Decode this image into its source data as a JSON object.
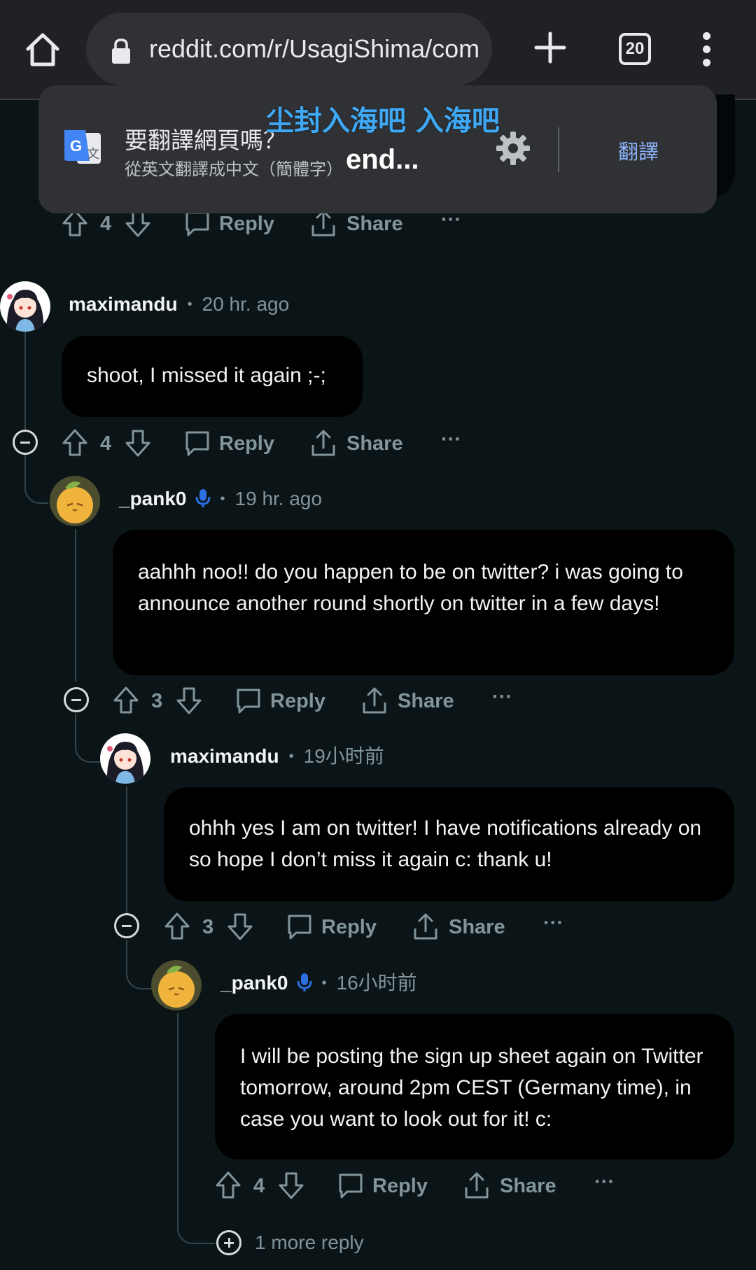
{
  "browser": {
    "url": "reddit.com/r/UsagiShima/com",
    "tab_count": "20",
    "icons": [
      "home-icon",
      "lock-icon",
      "plus-icon",
      "tab-switcher-icon",
      "more-vert-icon"
    ]
  },
  "translate_prompt": {
    "title": "要翻譯網頁嗎？",
    "subtitle": "從英文翻譯成中文（簡體字）",
    "action": "翻譯",
    "icons": [
      "google-translate-icon",
      "gear-icon"
    ]
  },
  "overlay": {
    "caption": "尘封入海吧 入海吧",
    "truncated_text": "end..."
  },
  "labels": {
    "reply": "Reply",
    "share": "Share",
    "more": "···"
  },
  "comments": [
    {
      "id": "c0",
      "score": "4"
    },
    {
      "id": "c1",
      "author": "maximandu",
      "time": "20 hr. ago",
      "text": "shoot, I missed it again ;-;",
      "score": "4"
    },
    {
      "id": "c2",
      "author": "_pank0",
      "time": "19 hr. ago",
      "text": "aahhh noo!! do you happen to be on twitter? i was going to announce another round shortly on twitter in a few days!",
      "score": "3",
      "badge": "mic-icon"
    },
    {
      "id": "c3",
      "author": "maximandu",
      "time": "19小时前",
      "text": "ohhh yes I am on twitter! I have notifications already on so hope I don’t miss it again c: thank u!",
      "score": "3"
    },
    {
      "id": "c4",
      "author": "_pank0",
      "time": "16小时前",
      "text": "I will be posting the sign up sheet again on Twitter tomorrow, around 2pm CEST (Germany time), in case you want to look out for it! c:",
      "score": "4",
      "badge": "mic-icon"
    }
  ],
  "more_replies": "1 more reply",
  "colors": {
    "background": "#0b1416",
    "bubble": "#000000",
    "muted_text": "#82959b",
    "thread_line": "#33464c",
    "mod_blue": "#2c6fe0",
    "translate_blue": "#8ab4f8"
  }
}
